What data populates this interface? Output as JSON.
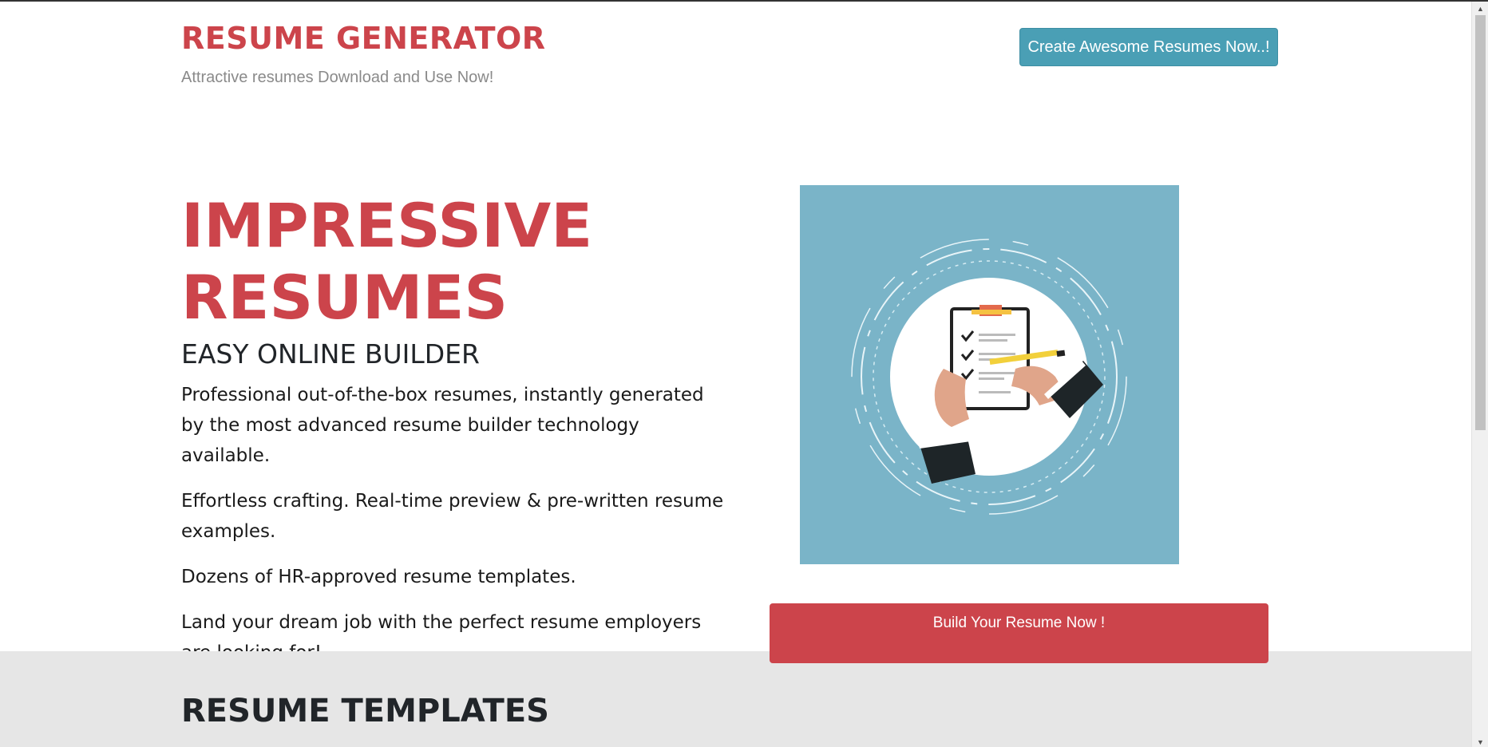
{
  "header": {
    "brand_title": "RESUME GENERATOR",
    "tagline": "Attractive resumes Download and Use Now!",
    "cta_label": "Create Awesome Resumes Now..!"
  },
  "hero": {
    "title_line1": "IMPRESSIVE",
    "title_line2": "RESUMES",
    "subtitle": "EASY ONLINE BUILDER",
    "paragraphs": [
      "Professional out-of-the-box resumes, instantly generated by the most advanced resume builder technology available.",
      "Effortless crafting. Real-time preview & pre-written resume examples.",
      "Dozens of HR-approved resume templates.",
      "Land your dream job with the perfect resume employers are looking for!"
    ],
    "image_icon": "clipboard-checklist-illustration",
    "build_button_label": "Build Your Resume Now !"
  },
  "templates": {
    "title": "RESUME TEMPLATES"
  },
  "colors": {
    "brand_red": "#cc444b",
    "cta_teal": "#4a9fb5",
    "image_bg": "#7ab4c8",
    "section_gray": "#e6e6e6"
  }
}
